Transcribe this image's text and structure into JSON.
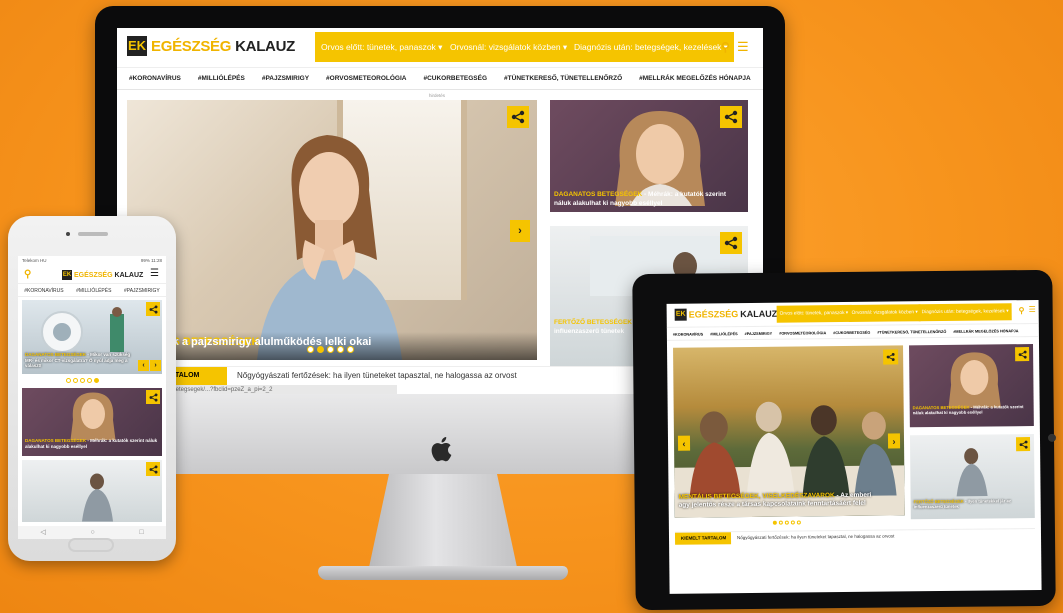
{
  "site": {
    "logo_part1": "EGÉSZSÉG",
    "logo_part2": "KALAUZ",
    "logo_mark": "EK",
    "accent": "#f5c400",
    "background": "#f7941d"
  },
  "nav": {
    "btn1": "Orvos előtt: tünetek, panaszok ▾",
    "btn2": "Orvosnál: vizsgálatok közben ▾",
    "btn3": "Diagnózis után: betegségek, kezelések ▾",
    "search_icon": "search-icon",
    "menu_icon": "hamburger-icon"
  },
  "tags": [
    "#KORONAVÍRUS",
    "#MILLIÓLÉPÉS",
    "#PAJZSMIRIGY",
    "#ORVOSMETEOROLÓGIA",
    "#CUKORBETEGSÉG",
    "#TÜNETKERESŐ, TÜNETELLENŐRZŐ",
    "#MELLRÁK MEGELŐZÉS HÓNAPJA"
  ],
  "ad_label": "hirdetés",
  "hero": {
    "category": "NÁLIS BETEGSÉGEK",
    "title": " - Ezek a pajzsmirigy alulműködés lelki okai"
  },
  "side1": {
    "category": "DAGANATOS BETEGSÉGEK",
    "title": " - Méhrák: a kutatók szerint náluk alakulhat ki nagyobb eséllyel"
  },
  "side2": {
    "category": "FERTŐZŐ BETEGSÉGEK",
    "title": " - Ilyen tünetekkel jár az influenzaszerű tünetek"
  },
  "ticker": {
    "label": "TALOM",
    "text": "Nőgyógyászati fertőzések: ha ilyen tüneteket tapasztal, ne halogassa az orvost"
  },
  "status_url": "a-betegsegek/...?fbclid=pzeZ_a_pi=2_2",
  "phone": {
    "status_left": "Telekom HU",
    "status_right": "99% 11:28",
    "tags": [
      "#KORONAVÍRUS",
      "#MILLIÓLÉPÉS",
      "#PAJZSMIRIGY"
    ],
    "card1_cat": "DAGANATOS BETEGSÉGEK",
    "card1_title": " - Mikor van szükség MR- és mikor CT-vizsgálatra? Ő nyúl adja meg a választ!",
    "card2_cat": "DAGANATOS BETEGSÉGEK",
    "card2_title": " - Méhrák: a kutatók szerint náluk alakulhat ki nagyobb eséllyel"
  },
  "tablet": {
    "tags": [
      "#KORONAVÍRUS",
      "#MILLIÓLÉPÉS",
      "#PAJZSMIRIGY",
      "#ORVOSMETEOROLÓGIA",
      "#CUKORBETEGSÉG",
      "#TÜNETKERESŐ, TÜNETELLENŐRZŐ",
      "#MELLRÁK MEGELŐZÉS HÓNAPJA"
    ],
    "hero_cat": "MENTÁLIS BETEGSÉGEK, VISELKEDÉSZAVAROK",
    "hero_title": " - Az emberi agy jelentős része a társas kapcsolataink fenntartásáért felel",
    "side1_cat": "DAGANATOS BETEGSÉGEK",
    "side1_title": " - Méhrák: a kutatók szerint náluk alakulhat ki nagyobb eséllyel",
    "side2_cat": "FERTŐZŐ BETEGSÉGEK",
    "side2_title": " - Ilyen tünetekkel jár az influenzaszerű tünetek",
    "ticker_label": "KIEMELT TARTALOM",
    "ticker_text": "Nőgyógyászati fertőzések: ha ilyen tüneteket tapasztal, ne halogassa az orvost"
  }
}
